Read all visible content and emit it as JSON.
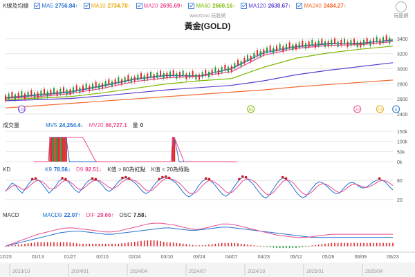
{
  "header": {
    "panel_label": "K線及均線",
    "watermark": "WantGoo 玩股網",
    "logo_text": "玩股網",
    "legend": [
      {
        "name": "MA5",
        "value": "2756.84↑",
        "color": "#1f6fd1"
      },
      {
        "name": "MA10",
        "value": "2734.78↑",
        "color": "#e6a700"
      },
      {
        "name": "MA20",
        "value": "2695.69↑",
        "color": "#e8478b"
      },
      {
        "name": "MA60",
        "value": "2660.16↑",
        "color": "#7ab800"
      },
      {
        "name": "MA120",
        "value": "2630.67↑",
        "color": "#5b3bcf"
      },
      {
        "name": "MA240",
        "value": "2484.27↑",
        "color": "#f26a2e"
      }
    ]
  },
  "volume_header": {
    "label": "成交量",
    "items": [
      {
        "name": "MV5",
        "value": "24,264.4↓",
        "color": "#1f6fd1"
      },
      {
        "name": "MV20",
        "value": "66,727.1",
        "color": "#e8478b"
      },
      {
        "name": "量",
        "value": "0",
        "color": "#333333"
      }
    ]
  },
  "kd_header": {
    "label": "KD",
    "items": [
      {
        "name": "K9",
        "value": "78.56↓",
        "color": "#1f6fd1"
      },
      {
        "name": "D9",
        "value": "82.51↓",
        "color": "#e8478b"
      },
      {
        "name": "K值 > 80為紅點",
        "value": "",
        "color": "#333333"
      },
      {
        "name": "K值 < 20為綠點",
        "value": "",
        "color": "#333333"
      }
    ]
  },
  "macd_header": {
    "label": "MACD",
    "items": [
      {
        "name": "MACD9",
        "value": "22.07↑",
        "color": "#1f6fd1"
      },
      {
        "name": "DIF",
        "value": "29.66↑",
        "color": "#e8478b"
      },
      {
        "name": "OSC",
        "value": "7.58↓",
        "color": "#333333"
      }
    ]
  },
  "colors": {
    "up": "#e0262b",
    "down": "#1a9e3a",
    "grid": "#e6e6e6",
    "axis_text": "#555555"
  },
  "chart_data": [
    {
      "type": "line",
      "title": "黃金(GOLD)",
      "x_tick_labels": [
        "12/23",
        "01/13",
        "01/27",
        "02/10",
        "02/24",
        "03/10",
        "03/24",
        "04/07",
        "04/23",
        "05/12",
        "05/26",
        "06/09",
        "06/23"
      ],
      "y_tick_labels": [
        "3400",
        "3200",
        "3000",
        "2800",
        "2600",
        "2400"
      ],
      "ylim": [
        2400,
        3500
      ],
      "x": [
        0,
        10,
        20,
        30,
        40,
        50,
        60,
        70,
        80,
        90,
        100,
        110,
        120
      ],
      "series": [
        {
          "name": "K線",
          "values": [
            2620,
            2660,
            2700,
            2780,
            2870,
            2920,
            2900,
            3010,
            3230,
            3300,
            3340,
            3330,
            3390
          ]
        },
        {
          "name": "MA5",
          "values": [
            2615,
            2650,
            2690,
            2770,
            2860,
            2910,
            2905,
            3000,
            3210,
            3290,
            3330,
            3340,
            3380
          ]
        },
        {
          "name": "MA20",
          "values": [
            2610,
            2630,
            2670,
            2740,
            2830,
            2880,
            2900,
            2960,
            3180,
            3270,
            3310,
            3320,
            3360
          ]
        },
        {
          "name": "MA60",
          "values": [
            2590,
            2610,
            2630,
            2680,
            2740,
            2800,
            2840,
            2870,
            3020,
            3140,
            3210,
            3260,
            3300
          ]
        },
        {
          "name": "MA120",
          "values": [
            2575,
            2590,
            2605,
            2640,
            2680,
            2720,
            2750,
            2780,
            2840,
            2920,
            2980,
            3030,
            3080
          ]
        },
        {
          "name": "MA240",
          "values": [
            2480,
            2510,
            2540,
            2570,
            2600,
            2630,
            2660,
            2690,
            2720,
            2760,
            2790,
            2820,
            2850
          ]
        }
      ],
      "markers": [
        {
          "label": "120",
          "x": 5
        },
        {
          "label": "60",
          "x": 76
        },
        {
          "label": "20",
          "x": 109
        },
        {
          "label": "10",
          "x": 116
        },
        {
          "label": "5",
          "x": 121
        }
      ]
    },
    {
      "type": "bar",
      "title": "成交量",
      "y_tick_labels": [
        "150k",
        "100k",
        "50k",
        "0k"
      ],
      "ylim": [
        0,
        150000
      ],
      "bars": [
        {
          "x": 10,
          "value": 120000,
          "dir": "up"
        },
        {
          "x": 11,
          "value": 120000,
          "dir": "up"
        },
        {
          "x": 12,
          "value": 120000,
          "dir": "down"
        },
        {
          "x": 13,
          "value": 120000,
          "dir": "up"
        },
        {
          "x": 14,
          "value": 120000,
          "dir": "down"
        },
        {
          "x": 15,
          "value": 120000,
          "dir": "up"
        },
        {
          "x": 16,
          "value": 120000,
          "dir": "up"
        },
        {
          "x": 17,
          "value": 120000,
          "dir": "down"
        },
        {
          "x": 18,
          "value": 120000,
          "dir": "up"
        },
        {
          "x": 19,
          "value": 120000,
          "dir": "up"
        },
        {
          "x": 20,
          "value": 120000,
          "dir": "up"
        },
        {
          "x": 86,
          "value": 120000,
          "dir": "up"
        },
        {
          "x": 87,
          "value": 120000,
          "dir": "up"
        }
      ],
      "series": [
        {
          "name": "MV5",
          "values": [
            0,
            0,
            0,
            0,
            0,
            0,
            0,
            0,
            0,
            0,
            120000,
            120000,
            120000,
            120000,
            120000,
            120000,
            120000,
            120000,
            120000,
            120000,
            120000,
            60000,
            0,
            0,
            0,
            0,
            0,
            0,
            0,
            0,
            0,
            0,
            0,
            0,
            0,
            0,
            0,
            0,
            0,
            0,
            0,
            0,
            0,
            0,
            0,
            0,
            0,
            0,
            0,
            0,
            0,
            0,
            0,
            0,
            0,
            0,
            0,
            0,
            0,
            0,
            0,
            0,
            0,
            0,
            0,
            0,
            0,
            0,
            0,
            0,
            0,
            0,
            0,
            0,
            0,
            0,
            0,
            0,
            0,
            0,
            0,
            0,
            0,
            0,
            0,
            0,
            120000,
            120000,
            80000,
            40000,
            0,
            0,
            0,
            0,
            0,
            0,
            0,
            0,
            0,
            0,
            0,
            0,
            0,
            0,
            0,
            0,
            0,
            0,
            0,
            0,
            0,
            0,
            0,
            0,
            0,
            0,
            0,
            0,
            0,
            0,
            0,
            0,
            0,
            0,
            0,
            0
          ]
        },
        {
          "name": "MV20",
          "values": [
            0,
            0,
            0,
            0,
            0,
            0,
            0,
            0,
            0,
            0,
            120000,
            120000,
            120000,
            120000,
            120000,
            120000,
            120000,
            120000,
            120000,
            120000,
            120000,
            120000,
            120000,
            120000,
            120000,
            120000,
            120000,
            120000,
            120000,
            120000,
            120000,
            110000,
            95000,
            80000,
            65000,
            50000,
            35000,
            20000,
            5000,
            0,
            0,
            0,
            0,
            0,
            0,
            0,
            0,
            0,
            0,
            0,
            0,
            0,
            0,
            0,
            0,
            0,
            0,
            0,
            0,
            0,
            0,
            0,
            0,
            0,
            0,
            0,
            0,
            0,
            0,
            0,
            0,
            0,
            0,
            0,
            0,
            0,
            0,
            0,
            0,
            0,
            0,
            0,
            0,
            0,
            0,
            0,
            120000,
            120000,
            100000,
            80000,
            60000,
            40000,
            20000,
            0,
            0,
            0,
            0,
            0,
            0,
            0,
            0,
            0,
            0,
            0,
            0,
            0,
            0,
            0,
            0,
            0,
            0,
            0,
            0,
            0,
            0,
            0,
            0,
            0,
            0,
            0,
            0,
            0,
            0,
            0,
            0,
            0,
            0
          ]
        }
      ]
    },
    {
      "type": "line",
      "title": "KD",
      "y_tick_labels": [
        "80",
        "20"
      ],
      "ylim": [
        0,
        100
      ],
      "series": [
        {
          "name": "K9",
          "values": [
            45,
            60,
            72,
            65,
            50,
            40,
            55,
            70,
            82,
            84,
            80,
            68,
            55,
            40,
            50,
            62,
            78,
            85,
            82,
            74,
            60,
            48,
            42,
            55,
            70,
            80,
            84,
            82,
            76,
            65,
            52,
            45,
            52,
            66,
            78,
            86,
            88,
            84,
            78,
            70,
            58,
            46,
            38,
            44,
            58,
            72,
            82,
            88,
            90,
            86,
            80,
            72,
            60,
            46,
            34,
            28,
            36,
            50,
            66,
            78,
            84,
            82,
            74,
            62,
            48,
            36,
            30,
            38,
            52,
            68,
            82,
            90,
            88,
            80,
            70,
            56,
            42,
            30,
            24,
            34,
            50,
            66,
            80,
            88,
            84,
            74,
            60,
            44,
            32,
            26,
            30,
            44,
            58,
            70,
            76,
            72,
            64,
            54,
            44,
            38,
            40,
            52,
            64,
            72,
            74,
            68,
            60,
            56,
            58,
            66,
            74,
            80,
            84,
            80,
            72,
            60,
            50
          ]
        },
        {
          "name": "D9",
          "values": [
            48,
            54,
            62,
            65,
            60,
            52,
            52,
            60,
            70,
            78,
            80,
            76,
            68,
            56,
            52,
            56,
            66,
            76,
            80,
            78,
            70,
            60,
            52,
            52,
            60,
            70,
            78,
            80,
            80,
            74,
            66,
            58,
            54,
            58,
            66,
            76,
            82,
            84,
            82,
            78,
            70,
            60,
            50,
            46,
            50,
            60,
            70,
            80,
            86,
            86,
            84,
            78,
            72,
            62,
            50,
            40,
            38,
            42,
            52,
            64,
            74,
            80,
            78,
            72,
            64,
            54,
            44,
            40,
            44,
            54,
            66,
            78,
            84,
            84,
            80,
            72,
            60,
            48,
            38,
            34,
            40,
            52,
            64,
            76,
            82,
            80,
            74,
            62,
            50,
            40,
            34,
            38,
            46,
            58,
            66,
            70,
            68,
            62,
            54,
            46,
            42,
            46,
            54,
            62,
            68,
            68,
            64,
            60,
            58,
            60,
            66,
            72,
            78,
            80,
            78,
            72,
            64
          ]
        }
      ]
    },
    {
      "type": "bar",
      "title": "MACD",
      "series": [
        {
          "name": "MACD9",
          "values": [
            0,
            2,
            4,
            6,
            8,
            10,
            12,
            14,
            16,
            18,
            20,
            22,
            24,
            26,
            28,
            30,
            32,
            34,
            35,
            36,
            37,
            38,
            38,
            38,
            37,
            36,
            35,
            34,
            33,
            32,
            31,
            30,
            30,
            30,
            31,
            32,
            33,
            34,
            35,
            36,
            37,
            38,
            39,
            40,
            41,
            42,
            43,
            44,
            45,
            46,
            46,
            46,
            45,
            44,
            43,
            42,
            41,
            40,
            40,
            40,
            41,
            42,
            43,
            44,
            45,
            46,
            47,
            48,
            48,
            48,
            47,
            46,
            45,
            44,
            43,
            42,
            41,
            40,
            39,
            38,
            37,
            36,
            35,
            34,
            33,
            32,
            31,
            30,
            29,
            28,
            27,
            26,
            25,
            24,
            23,
            22,
            22,
            22,
            22,
            22,
            22,
            22,
            22,
            22,
            22,
            22,
            22,
            22,
            22,
            22,
            22,
            22,
            22,
            22,
            22,
            22,
            22,
            22,
            22,
            22,
            22
          ]
        },
        {
          "name": "DIF",
          "values": [
            0,
            3,
            6,
            9,
            12,
            15,
            18,
            21,
            24,
            27,
            30,
            32,
            34,
            36,
            38,
            40,
            42,
            44,
            45,
            46,
            46,
            46,
            45,
            44,
            43,
            42,
            41,
            40,
            39,
            38,
            37,
            36,
            36,
            36,
            37,
            38,
            40,
            42,
            44,
            46,
            48,
            50,
            52,
            54,
            56,
            57,
            58,
            58,
            58,
            57,
            56,
            55,
            54,
            52,
            50,
            48,
            46,
            44,
            43,
            42,
            43,
            44,
            46,
            48,
            50,
            52,
            54,
            56,
            56,
            56,
            55,
            54,
            52,
            50,
            48,
            46,
            44,
            42,
            40,
            38,
            36,
            34,
            32,
            30,
            28,
            27,
            26,
            25,
            24,
            23,
            22,
            22,
            22,
            22,
            23,
            24,
            25,
            26,
            27,
            28,
            29,
            30,
            30,
            30,
            30,
            30,
            30,
            30,
            30,
            30,
            30,
            30,
            30,
            30,
            30,
            30,
            30,
            30,
            30,
            30,
            30
          ]
        }
      ]
    }
  ],
  "bottom_axis": {
    "date_labels": [
      "12/23",
      "01/13",
      "01/27",
      "02/10",
      "02/24",
      "03/10",
      "03/24",
      "04/07",
      "04/23",
      "05/12",
      "05/26",
      "06/09",
      "06/23"
    ],
    "period_labels": [
      "2023/10",
      "2024/01",
      "2024/04",
      "2024/07",
      "2024/10",
      "2025/01",
      "2025/04"
    ]
  }
}
